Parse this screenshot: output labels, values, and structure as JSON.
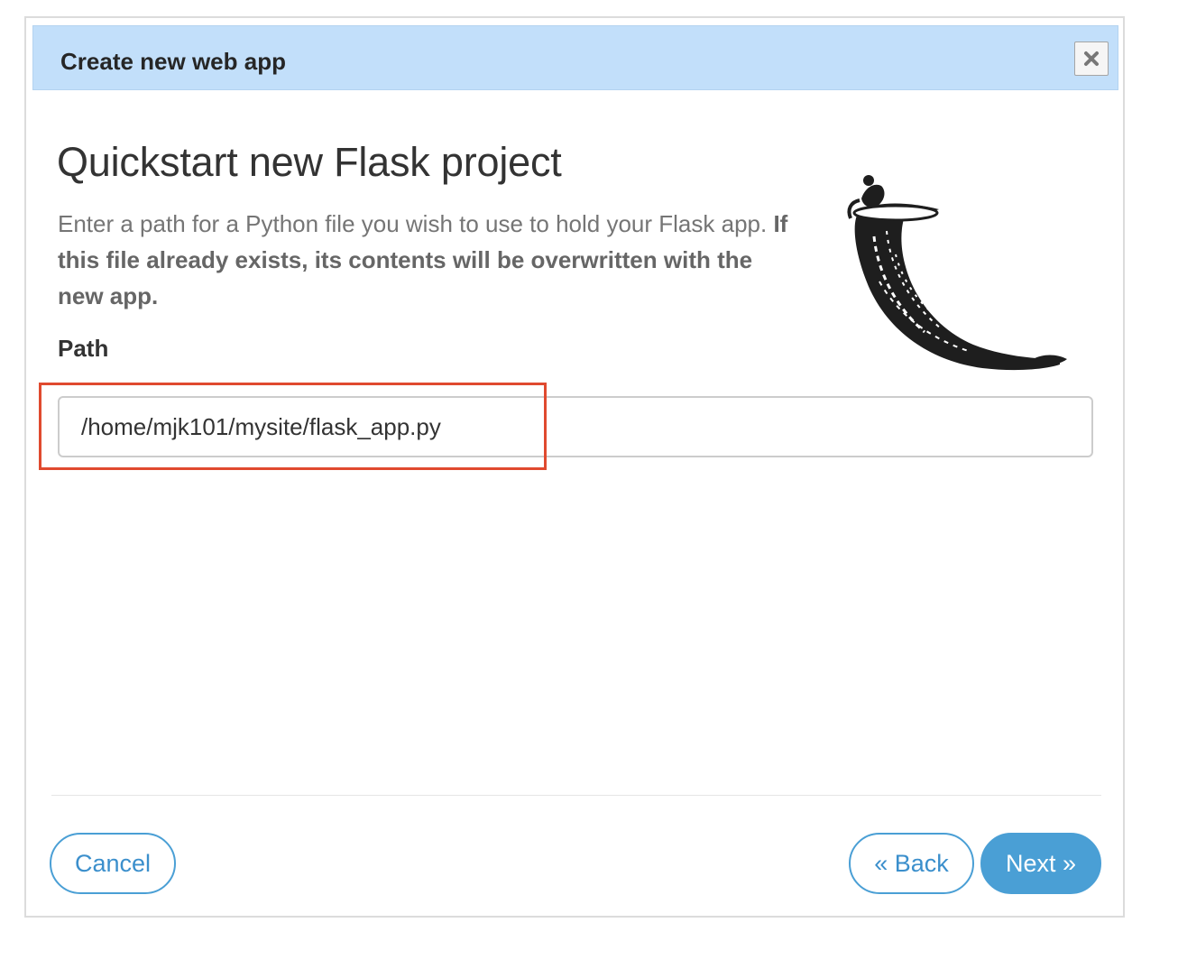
{
  "dialog": {
    "title": "Create new web app",
    "close_icon": "close-x-icon"
  },
  "content": {
    "heading": "Quickstart new Flask project",
    "description_plain": "Enter a path for a Python file you wish to use to hold your Flask app. ",
    "description_bold": "If this file already exists, its contents will be overwritten with the new app.",
    "path_label": "Path",
    "path_value": "/home/mjk101/mysite/flask_app.py",
    "logo_icon": "flask-horn-logo"
  },
  "footer": {
    "cancel_label": "Cancel",
    "back_label": "« Back",
    "next_label": "Next »"
  },
  "colors": {
    "titlebar_bg": "#c2dffa",
    "accent_blue": "#4a9fd5",
    "highlight_red": "#e04a2f"
  }
}
